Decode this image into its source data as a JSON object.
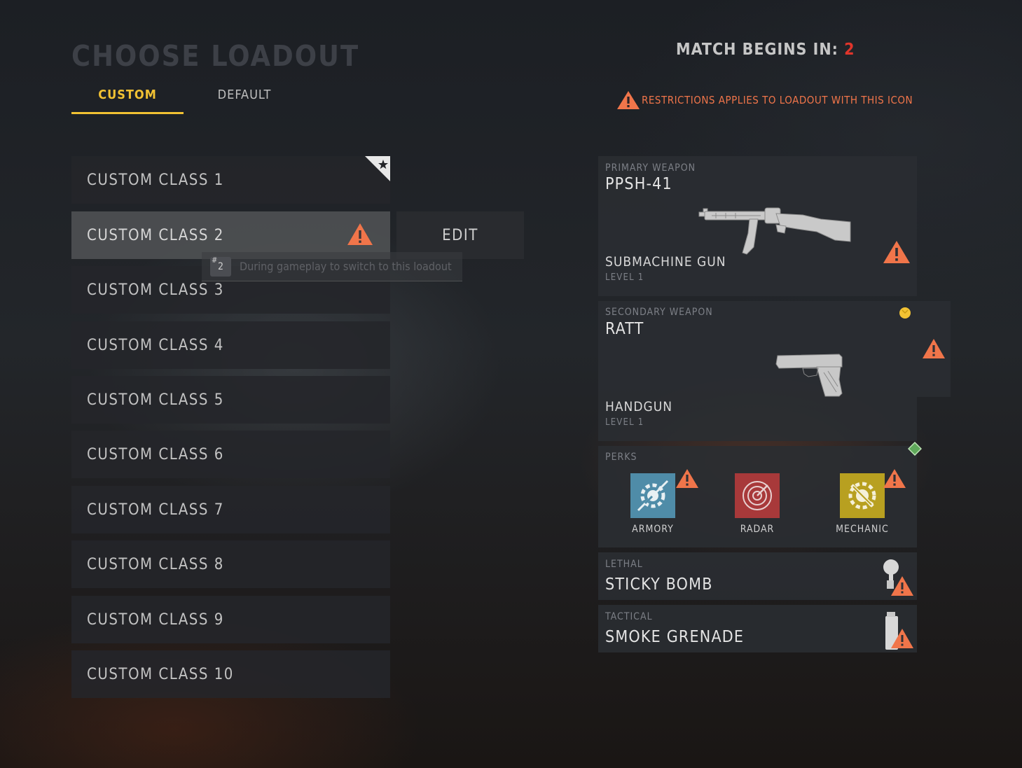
{
  "header": {
    "title": "CHOOSE LOADOUT",
    "tabs": [
      {
        "label": "CUSTOM",
        "active": true
      },
      {
        "label": "DEFAULT",
        "active": false
      }
    ],
    "match_label": "MATCH BEGINS IN:",
    "match_count": "2",
    "restriction_notice": "RESTRICTIONS APPLIES TO LOADOUT WITH THIS ICON"
  },
  "classes": [
    {
      "label": "CUSTOM CLASS 1",
      "favorite": true
    },
    {
      "label": "CUSTOM CLASS 2",
      "selected": true,
      "restricted": true
    },
    {
      "label": "CUSTOM CLASS 3"
    },
    {
      "label": "CUSTOM CLASS 4"
    },
    {
      "label": "CUSTOM CLASS 5"
    },
    {
      "label": "CUSTOM CLASS 6"
    },
    {
      "label": "CUSTOM CLASS 7"
    },
    {
      "label": "CUSTOM CLASS 8"
    },
    {
      "label": "CUSTOM CLASS 9"
    },
    {
      "label": "CUSTOM CLASS 10"
    }
  ],
  "edit_label": "EDIT",
  "hint": {
    "key_symbol": "#",
    "key_number": "2",
    "text": "During gameplay to switch to this loadout"
  },
  "loadout": {
    "primary": {
      "label": "PRIMARY WEAPON",
      "name": "PPSH-41",
      "type": "SUBMACHINE GUN",
      "level": "LEVEL 1",
      "icon": "smg-icon",
      "restricted": true
    },
    "secondary": {
      "label": "SECONDARY WEAPON",
      "name": "RATT",
      "type": "HANDGUN",
      "level": "LEVEL 1",
      "icon": "pistol-icon",
      "restricted": true
    },
    "perks": {
      "label": "PERKS",
      "items": [
        {
          "name": "ARMORY",
          "icon": "armory-icon",
          "color": "#4f8ca8",
          "restricted": true
        },
        {
          "name": "RADAR",
          "icon": "radar-icon",
          "color": "#a8393a",
          "restricted": false
        },
        {
          "name": "MECHANIC",
          "icon": "mechanic-icon",
          "color": "#b8a020",
          "restricted": true
        }
      ]
    },
    "lethal": {
      "label": "LETHAL",
      "name": "STICKY BOMB",
      "icon": "sticky-bomb-icon",
      "restricted": true
    },
    "tactical": {
      "label": "TACTICAL",
      "name": "SMOKE GRENADE",
      "icon": "smoke-grenade-icon",
      "restricted": true
    }
  },
  "colors": {
    "accent": "#f2c233",
    "warning": "#f0754a",
    "countdown": "#e0352b"
  }
}
